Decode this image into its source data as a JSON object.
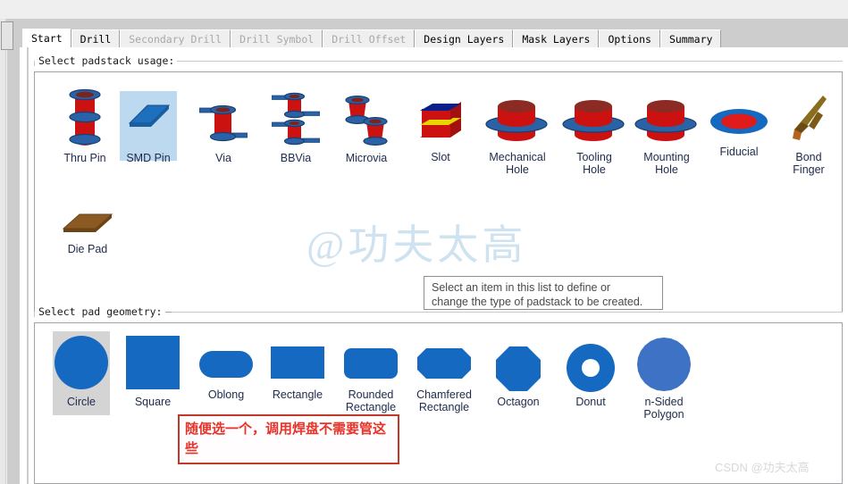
{
  "window": {
    "tabs": [
      {
        "label": "Start",
        "state": "active"
      },
      {
        "label": "Drill",
        "state": "normal"
      },
      {
        "label": "Secondary Drill",
        "state": "disabled"
      },
      {
        "label": "Drill Symbol",
        "state": "disabled"
      },
      {
        "label": "Drill Offset",
        "state": "disabled"
      },
      {
        "label": "Design Layers",
        "state": "normal"
      },
      {
        "label": "Mask Layers",
        "state": "normal"
      },
      {
        "label": "Options",
        "state": "normal"
      },
      {
        "label": "Summary",
        "state": "normal"
      }
    ]
  },
  "padstack_usage": {
    "group_label": "Select padstack usage:",
    "items": [
      {
        "label": "Thru Pin",
        "icon": "thru-pin-icon",
        "selected": false
      },
      {
        "label": "SMD Pin",
        "icon": "smd-pin-icon",
        "selected": true
      },
      {
        "label": "Via",
        "icon": "via-icon",
        "selected": false
      },
      {
        "label": "BBVia",
        "icon": "bbvia-icon",
        "selected": false
      },
      {
        "label": "Microvia",
        "icon": "microvia-icon",
        "selected": false
      },
      {
        "label": "Slot",
        "icon": "slot-icon",
        "selected": false
      },
      {
        "label": "Mechanical\nHole",
        "icon": "mechanical-hole-icon",
        "selected": false
      },
      {
        "label": "Tooling\nHole",
        "icon": "tooling-hole-icon",
        "selected": false
      },
      {
        "label": "Mounting\nHole",
        "icon": "mounting-hole-icon",
        "selected": false
      },
      {
        "label": "Fiducial",
        "icon": "fiducial-icon",
        "selected": false
      },
      {
        "label": "Bond\nFinger",
        "icon": "bond-finger-icon",
        "selected": false
      },
      {
        "label": "Die Pad",
        "icon": "die-pad-icon",
        "selected": false
      }
    ]
  },
  "pad_geometry": {
    "group_label": "Select pad geometry:",
    "items": [
      {
        "label": "Circle",
        "icon": "circle-shape-icon",
        "selected": true
      },
      {
        "label": "Square",
        "icon": "square-shape-icon",
        "selected": false
      },
      {
        "label": "Oblong",
        "icon": "oblong-shape-icon",
        "selected": false
      },
      {
        "label": "Rectangle",
        "icon": "rectangle-shape-icon",
        "selected": false
      },
      {
        "label": "Rounded\nRectangle",
        "icon": "rounded-rectangle-shape-icon",
        "selected": false
      },
      {
        "label": "Chamfered\nRectangle",
        "icon": "chamfered-rectangle-shape-icon",
        "selected": false
      },
      {
        "label": "Octagon",
        "icon": "octagon-shape-icon",
        "selected": false
      },
      {
        "label": "Donut",
        "icon": "donut-shape-icon",
        "selected": false
      },
      {
        "label": "n-Sided\nPolygon",
        "icon": "n-sided-polygon-shape-icon",
        "selected": false
      }
    ]
  },
  "tooltip": {
    "line1": "Select an item in this list to define or",
    "line2": "change the type of padstack to be created."
  },
  "annotation": {
    "text": "随便选一个，调用焊盘不需要管这些"
  },
  "watermarks": {
    "center": "@功夫太高",
    "corner": "CSDN @功夫太高"
  },
  "colors": {
    "pad_blue": "#1569c0",
    "pin_red": "#cc1111",
    "disc_blue": "#2a62a8",
    "selection_gray": "#d4d4d4",
    "selection_sky": "#bdd9f0",
    "annotation_red": "#e8332a",
    "caption_navy": "#1e2a4a"
  }
}
